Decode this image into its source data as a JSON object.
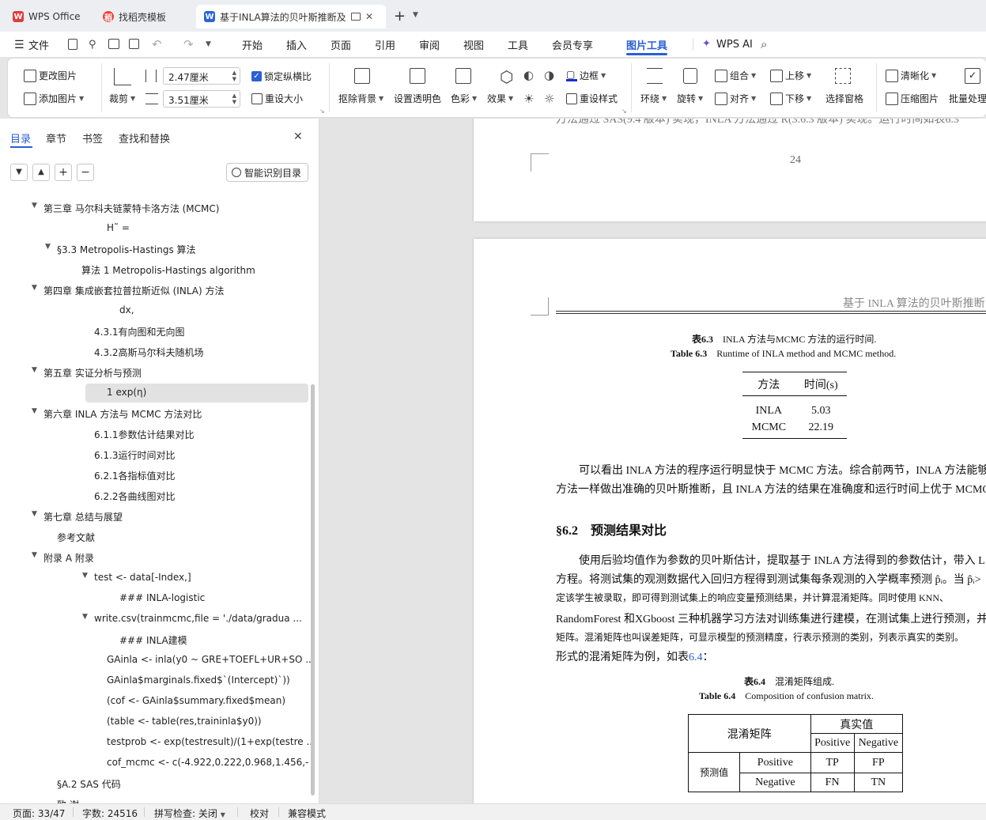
{
  "tabs": [
    {
      "label": "WPS Office",
      "icon": "wps-logo-icon"
    },
    {
      "label": "找稻壳模板",
      "icon": "docer-logo-icon"
    },
    {
      "label": "基于INLA算法的贝叶斯推断及",
      "icon": "word-doc-icon"
    }
  ],
  "new_tab": "+",
  "menu": {
    "file": "文件",
    "items": [
      "开始",
      "插入",
      "页面",
      "引用",
      "审阅",
      "视图",
      "工具",
      "会员专享",
      "图片工具"
    ],
    "active": "图片工具",
    "wps_ai": "WPS AI"
  },
  "ribbon": {
    "change_picture": "更改图片",
    "add_picture": "添加图片",
    "crop": "裁剪",
    "height_value": "2.47厘米",
    "width_value": "3.51厘米",
    "lock_ratio": "锁定纵横比",
    "reset_size": "重设大小",
    "remove_bg": "抠除背景",
    "set_transparent": "设置透明色",
    "color": "色彩",
    "effects": "效果",
    "border": "边框",
    "reset_style": "重设样式",
    "wrap": "环绕",
    "rotate": "旋转",
    "group": "组合",
    "align": "对齐",
    "move_up": "上移",
    "move_down": "下移",
    "selection_pane": "选择窗格",
    "sharpen": "清晰化",
    "compress": "压缩图片",
    "batch": "批量处理"
  },
  "nav": {
    "tabs": [
      "目录",
      "章节",
      "书签",
      "查找和替换"
    ],
    "smart_toc": "智能识别目录",
    "toc": [
      {
        "text": "第三章 马尔科夫链蒙特卡洛方法 (MCMC)",
        "level": 0,
        "arrow": true
      },
      {
        "text": "H˜ =",
        "level": 4,
        "arrow": false
      },
      {
        "text": "§3.3 Metropolis-Hastings 算法",
        "level": 1,
        "arrow": true
      },
      {
        "text": "算法 1 Metropolis-Hastings algorithm",
        "level": 2,
        "arrow": false
      },
      {
        "text": "第四章 集成嵌套拉普拉斯近似 (INLA) 方法",
        "level": 0,
        "arrow": true
      },
      {
        "text": "dx,",
        "level": 5,
        "arrow": false
      },
      {
        "text": "4.3.1有向图和无向图",
        "level": 3,
        "arrow": false
      },
      {
        "text": "4.3.2高斯马尔科夫随机场",
        "level": 3,
        "arrow": false
      },
      {
        "text": "第五章 实证分析与预测",
        "level": 0,
        "arrow": true
      },
      {
        "text": "1 exp(η)",
        "level": 4,
        "arrow": false,
        "selected": true
      },
      {
        "text": "第六章 INLA 方法与 MCMC 方法对比",
        "level": 0,
        "arrow": true
      },
      {
        "text": "6.1.1参数估计结果对比",
        "level": 3,
        "arrow": false
      },
      {
        "text": "6.1.3运行时间对比",
        "level": 3,
        "arrow": false
      },
      {
        "text": "6.2.1各指标值对比",
        "level": 3,
        "arrow": false
      },
      {
        "text": "6.2.2各曲线图对比",
        "level": 3,
        "arrow": false
      },
      {
        "text": "第七章 总结与展望",
        "level": 0,
        "arrow": true
      },
      {
        "text": "参考文献",
        "level": 1,
        "arrow": false
      },
      {
        "text": "附录 A 附录",
        "level": 0,
        "arrow": true
      },
      {
        "text": "test <- data[-Index,]",
        "level": 3,
        "arrow": true
      },
      {
        "text": "### INLA-logistic",
        "level": 5,
        "arrow": false
      },
      {
        "text": "write.csv(trainmcmc,file = './data/gradua ...",
        "level": 3,
        "arrow": true
      },
      {
        "text": "### INLA建模",
        "level": 5,
        "arrow": false
      },
      {
        "text": "GAinla <- inla(y0 ~ GRE+TOEFL+UR+SO ...",
        "level": 4,
        "arrow": false
      },
      {
        "text": "GAinla$marginals.fixed$`(Intercept)`))",
        "level": 4,
        "arrow": false
      },
      {
        "text": "(cof <- GAinla$summary.fixed$mean)",
        "level": 4,
        "arrow": false
      },
      {
        "text": "(table <- table(res,traininla$y0))",
        "level": 4,
        "arrow": false
      },
      {
        "text": "testprob <- exp(testresult)/(1+exp(testre ...",
        "level": 4,
        "arrow": false
      },
      {
        "text": "cof_mcmc <- c(-4.922,0.222,0.968,1.456,- ...",
        "level": 4,
        "arrow": false
      },
      {
        "text": "§A.2 SAS 代码",
        "level": 1,
        "arrow": false
      },
      {
        "text": "致 谢",
        "level": 1,
        "arrow": false
      }
    ]
  },
  "doc": {
    "top_cut_text": "方法通过 SAS(9.4 版本) 实现，INLA 方法通过 R(3.6.3 版本) 实现。运行时间如表6.3",
    "page_number": "24",
    "header": "基于 INLA 算法的贝叶斯推断",
    "table63_cn_label": "表6.3",
    "table63_cn_title": "INLA 方法与MCMC 方法的运行时间.",
    "table63_en_label": "Table 6.3",
    "table63_en_title": "Runtime of INLA method and MCMC method.",
    "table63": {
      "headers": [
        "方法",
        "时间(s)"
      ],
      "rows": [
        [
          "INLA",
          "5.03"
        ],
        [
          "MCMC",
          "22.19"
        ]
      ]
    },
    "para1_line1": "可以看出 INLA 方法的程序运行明显快于 MCMC 方法。综合前两节，INLA 方法能够",
    "para1_line2": "方法一样做出准确的贝叶斯推断，且 INLA 方法的结果在准确度和运行时间上优于 MCMC",
    "section_num": "§6.2",
    "section_title": "预测结果对比",
    "para2_line1": "使用后验均值作为参数的贝叶斯估计，提取基于 INLA 方法得到的参数估计，带入 L",
    "para2_line2": "方程。将测试集的观测数据代入回归方程得到测试集每条观测的入学概率预测 p̂ᵢ。当 p̂ᵢ>",
    "para2_line3": "定该学生被录取，即可得到测试集上的响应变量预测结果，并计算混淆矩阵。同时使用 KNN、",
    "para2_line4": "RandomForest 和XGboost 三种机器学习方法对训练集进行建模，在测试集上进行预测，并",
    "para2_line5": "矩阵。混淆矩阵也叫误差矩阵，可显示模型的预测精度，行表示预测的类别，列表示真实的类别。",
    "para2_line6_a": "形式的混淆矩阵为例，如表",
    "para2_line6_link": "6.4",
    "para2_line6_b": "：",
    "table64_cn_label": "表6.4",
    "table64_cn_title": "混淆矩阵组成.",
    "table64_en_label": "Table 6.4",
    "table64_en_title": "Composition of confusion matrix.",
    "table64": {
      "corner": "混淆矩阵",
      "true_header": "真实值",
      "col_pos": "Positive",
      "col_neg": "Negative",
      "pred_header": "预测值",
      "row_pos": "Positive",
      "row_neg": "Negative",
      "tp": "TP",
      "fp": "FP",
      "fn": "FN",
      "tn": "TN"
    }
  },
  "status": {
    "page": "页面: 33/47",
    "words": "字数: 24516",
    "spell": "拼写检查: 关闭",
    "proof": "校对",
    "compat": "兼容模式"
  },
  "colors": {
    "accent": "#2a5fd6",
    "wps_red": "#e23c3c",
    "word_blue": "#2b63d9"
  }
}
